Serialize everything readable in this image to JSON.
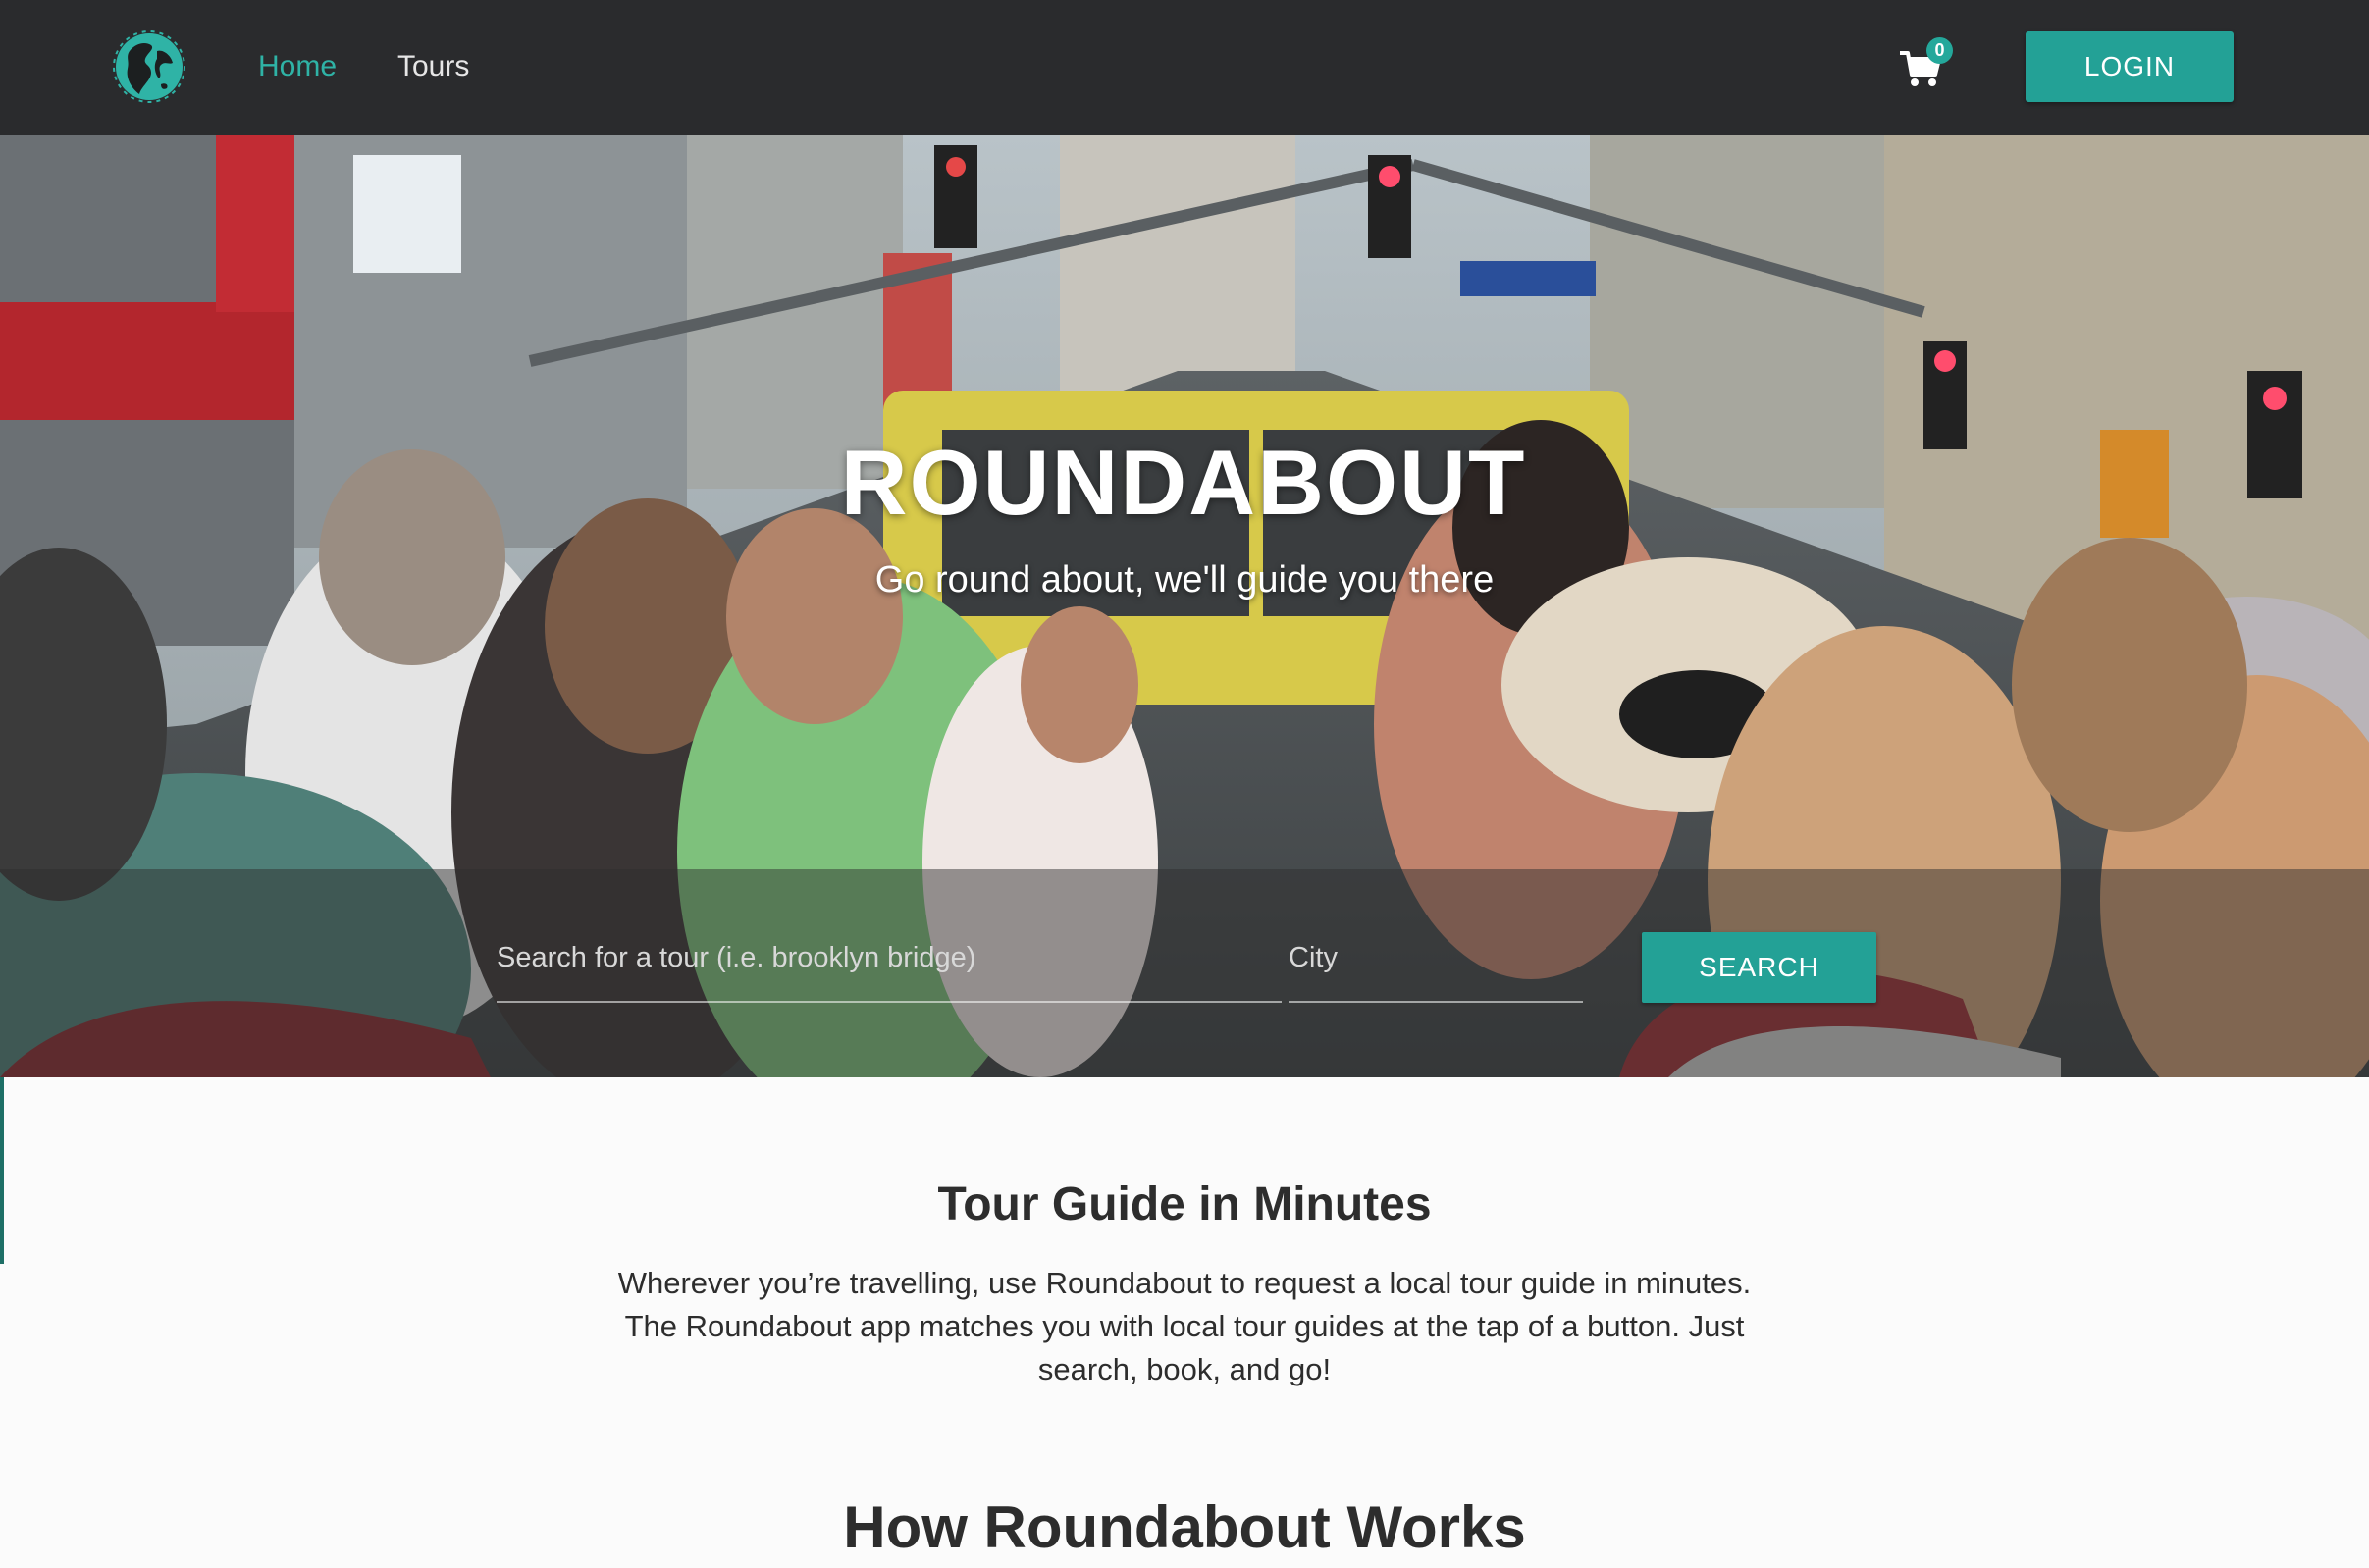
{
  "navbar": {
    "logo_icon": "globe-icon",
    "links": [
      {
        "label": "Home",
        "active": true
      },
      {
        "label": "Tours",
        "active": false
      }
    ],
    "cart_icon": "shopping-cart-icon",
    "cart_count": "0",
    "login_label": "LOGIN"
  },
  "hero": {
    "title": "ROUNDABOUT",
    "subtitle": "Go round about, we'll guide you there",
    "search_placeholder": "Search for a tour (i.e. brooklyn bridge)",
    "city_placeholder": "City",
    "search_button": "SEARCH"
  },
  "intro": {
    "title": "Tour Guide in Minutes",
    "text": "Wherever you’re travelling, use Roundabout to request a local tour guide in minutes. The Roundabout app matches you with local tour guides at the tap of a button. Just search, book, and go!"
  },
  "how_it_works": {
    "title": "How Roundabout Works"
  },
  "colors": {
    "accent": "#23a196",
    "navbar_bg": "#2a2b2d",
    "text": "#2d2d2d"
  }
}
